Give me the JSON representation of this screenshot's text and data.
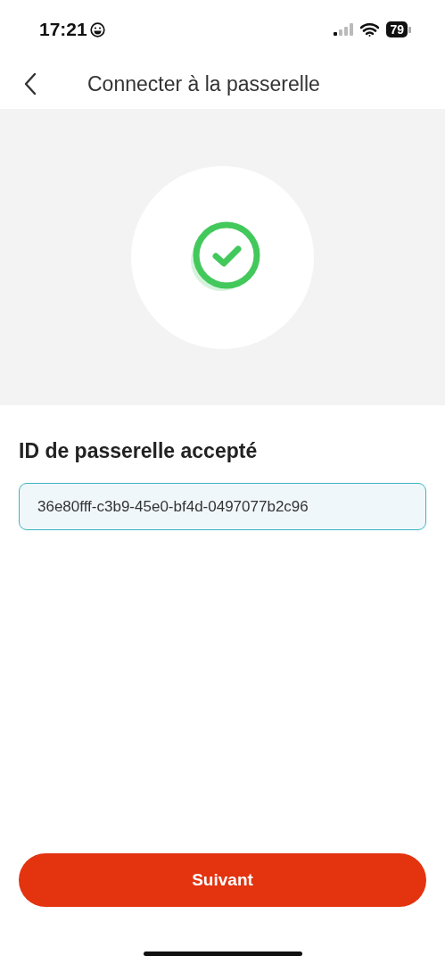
{
  "status_bar": {
    "time": "17:21",
    "battery": "79"
  },
  "header": {
    "title": "Connecter à la passerelle"
  },
  "heading": "ID de passerelle accepté",
  "gateway_id": {
    "value": "36e80fff-c3b9-45e0-bf4d-0497077b2c96"
  },
  "button": "Suivant"
}
